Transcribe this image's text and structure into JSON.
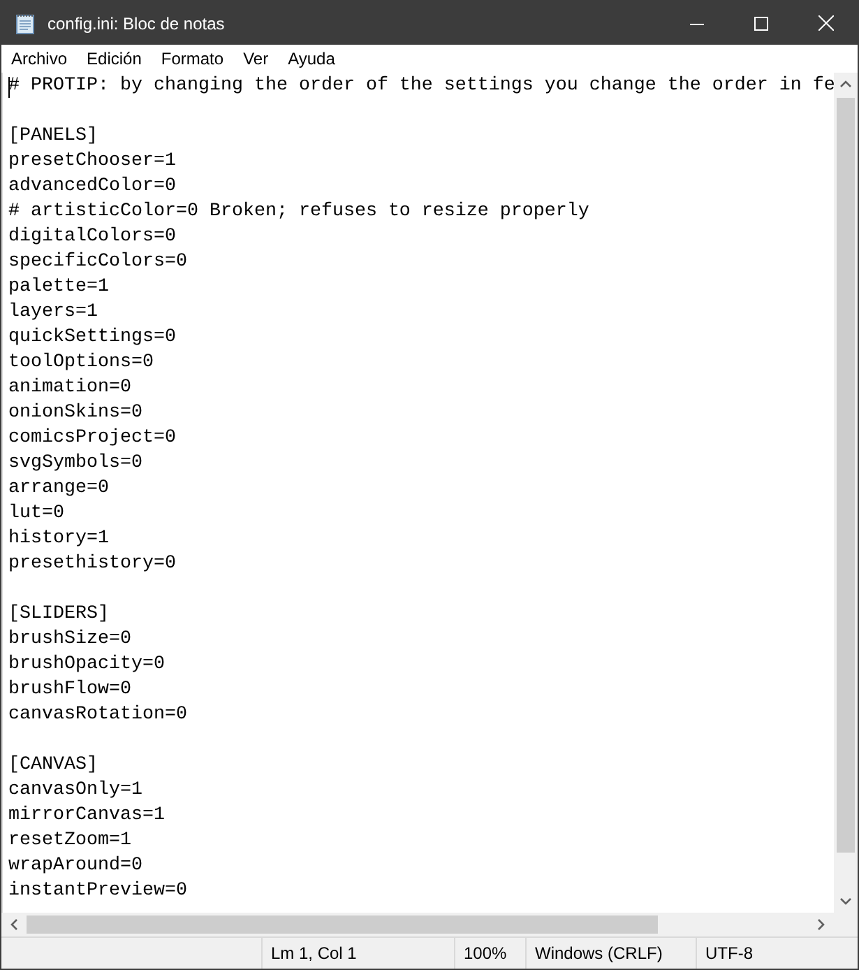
{
  "window": {
    "title": "config.ini: Bloc de notas"
  },
  "menu": [
    "Archivo",
    "Edición",
    "Formato",
    "Ver",
    "Ayuda"
  ],
  "editor": {
    "blocks": [
      [
        "# PROTIP: by changing the order of the settings you change the order in fe"
      ],
      [
        "[PANELS]",
        "presetChooser=1",
        "advancedColor=0",
        "# artisticColor=0 Broken; refuses to resize properly",
        "digitalColors=0",
        "specificColors=0",
        "palette=1",
        "layers=1",
        "quickSettings=0",
        "toolOptions=0",
        "animation=0",
        "onionSkins=0",
        "comicsProject=0",
        "svgSymbols=0",
        "arrange=0",
        "lut=0",
        "history=1",
        "presethistory=0"
      ],
      [
        "[SLIDERS]",
        "brushSize=0",
        "brushOpacity=0",
        "brushFlow=0",
        "canvasRotation=0"
      ],
      [
        "[CANVAS]",
        "canvasOnly=1",
        "mirrorCanvas=1",
        "resetZoom=1",
        "wrapAround=0",
        "instantPreview=0"
      ]
    ]
  },
  "status_bar": {
    "position": "Lm 1, Col 1",
    "zoom": "100%",
    "line_ending": "Windows (CRLF)",
    "encoding": "UTF-8"
  }
}
